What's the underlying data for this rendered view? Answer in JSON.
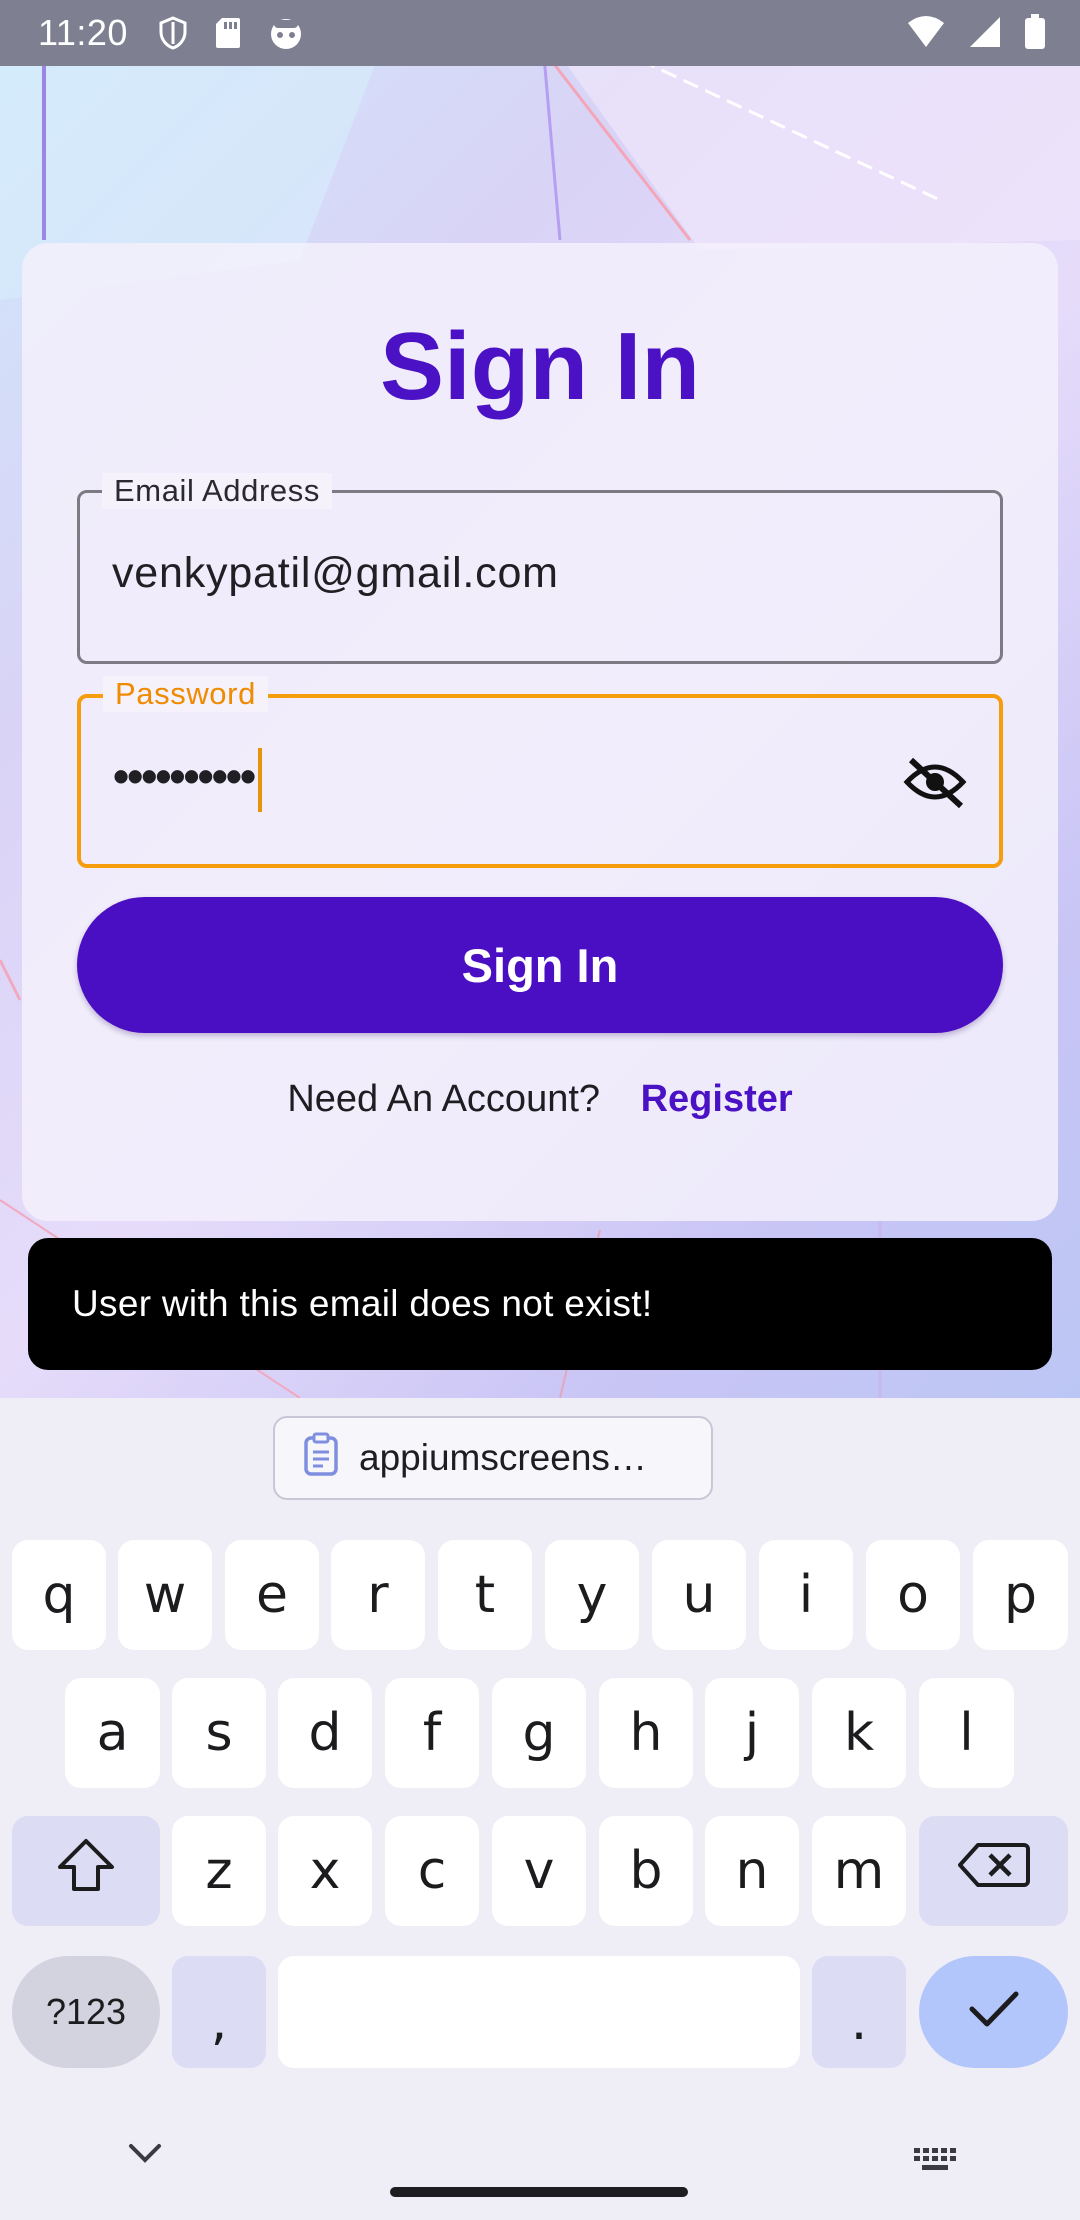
{
  "status_bar": {
    "time": "11:20",
    "left_icons": [
      "shield-icon",
      "sd-card-icon",
      "robot-icon"
    ],
    "right_icons": [
      "wifi-icon",
      "signal-icon",
      "battery-icon"
    ]
  },
  "sign_in": {
    "title": "Sign In",
    "email": {
      "label": "Email Address",
      "value": "venkypatil@gmail.com"
    },
    "password": {
      "label": "Password",
      "value": "••••••••••",
      "toggle_icon": "eye-off-icon"
    },
    "submit_label": "Sign In",
    "account_prompt": "Need An Account?",
    "register_label": "Register"
  },
  "toast": {
    "message": "User with this email does not exist!"
  },
  "keyboard": {
    "clipboard_suggestion": "appiumscreens…",
    "row1": [
      "q",
      "w",
      "e",
      "r",
      "t",
      "y",
      "u",
      "i",
      "o",
      "p"
    ],
    "row2": [
      "a",
      "s",
      "d",
      "f",
      "g",
      "h",
      "j",
      "k",
      "l"
    ],
    "row3": [
      "z",
      "x",
      "c",
      "v",
      "b",
      "n",
      "m"
    ],
    "symbols_label": "?123",
    "comma": ",",
    "period": "."
  },
  "colors": {
    "accent": "#4a12c4",
    "button": "#4a0fc3",
    "focus": "#f59d0c",
    "toast_bg": "#000000"
  }
}
